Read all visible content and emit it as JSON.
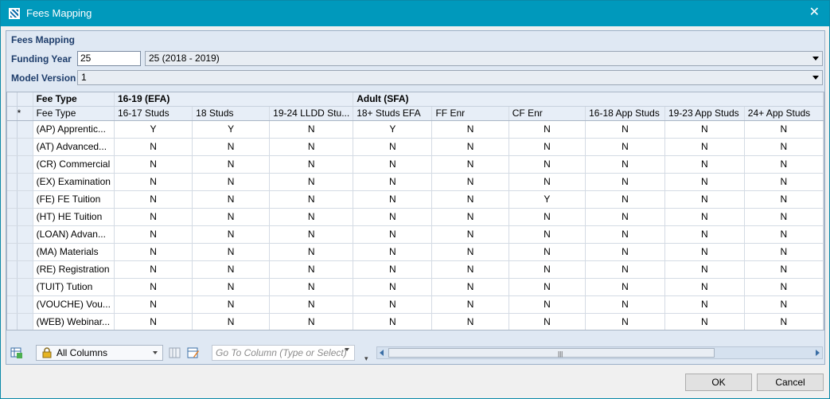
{
  "window": {
    "title": "Fees Mapping"
  },
  "form": {
    "group_title": "Fees Mapping",
    "funding_year_label": "Funding Year",
    "funding_year_code": "25",
    "funding_year_selected": "25 (2018 - 2019)",
    "model_version_label": "Model Version",
    "model_version_selected": "1"
  },
  "grid": {
    "bands": [
      {
        "label": "Fee Type"
      },
      {
        "label": "16-19 (EFA)"
      },
      {
        "label": "Adult (SFA)"
      }
    ],
    "new_row_marker": "*",
    "columns": [
      "Fee Type",
      "16-17 Studs",
      "18 Studs",
      "19-24 LLDD Stu...",
      "18+ Studs EFA",
      "FF Enr",
      "CF Enr",
      "16-18 App Studs",
      "19-23 App Studs",
      "24+ App Studs"
    ],
    "rows": [
      [
        "(AP) Apprentic...",
        "Y",
        "Y",
        "N",
        "Y",
        "N",
        "N",
        "N",
        "N",
        "N"
      ],
      [
        "(AT) Advanced...",
        "N",
        "N",
        "N",
        "N",
        "N",
        "N",
        "N",
        "N",
        "N"
      ],
      [
        "(CR) Commercial",
        "N",
        "N",
        "N",
        "N",
        "N",
        "N",
        "N",
        "N",
        "N"
      ],
      [
        "(EX) Examination",
        "N",
        "N",
        "N",
        "N",
        "N",
        "N",
        "N",
        "N",
        "N"
      ],
      [
        "(FE) FE Tuition",
        "N",
        "N",
        "N",
        "N",
        "N",
        "Y",
        "N",
        "N",
        "N"
      ],
      [
        "(HT) HE Tuition",
        "N",
        "N",
        "N",
        "N",
        "N",
        "N",
        "N",
        "N",
        "N"
      ],
      [
        "(LOAN) Advan...",
        "N",
        "N",
        "N",
        "N",
        "N",
        "N",
        "N",
        "N",
        "N"
      ],
      [
        "(MA) Materials",
        "N",
        "N",
        "N",
        "N",
        "N",
        "N",
        "N",
        "N",
        "N"
      ],
      [
        "(RE) Registration",
        "N",
        "N",
        "N",
        "N",
        "N",
        "N",
        "N",
        "N",
        "N"
      ],
      [
        "(TUIT) Tution",
        "N",
        "N",
        "N",
        "N",
        "N",
        "N",
        "N",
        "N",
        "N"
      ],
      [
        "(VOUCHE) Vou...",
        "N",
        "N",
        "N",
        "N",
        "N",
        "N",
        "N",
        "N",
        "N"
      ],
      [
        "(WEB) Webinar...",
        "N",
        "N",
        "N",
        "N",
        "N",
        "N",
        "N",
        "N",
        "N"
      ]
    ]
  },
  "toolbar": {
    "columns_filter": "All Columns",
    "goto_placeholder": "Go To Column (Type or Select)"
  },
  "buttons": {
    "ok": "OK",
    "cancel": "Cancel"
  },
  "colors": {
    "titlebar": "#0099bc",
    "header_text": "#1e3d6b",
    "panel": "#dfe8f3"
  },
  "icons": [
    "app-icon",
    "close-icon",
    "export-grid-icon",
    "lock-icon",
    "column-chooser-icon",
    "edit-grid-icon",
    "chevron-down-icon"
  ]
}
